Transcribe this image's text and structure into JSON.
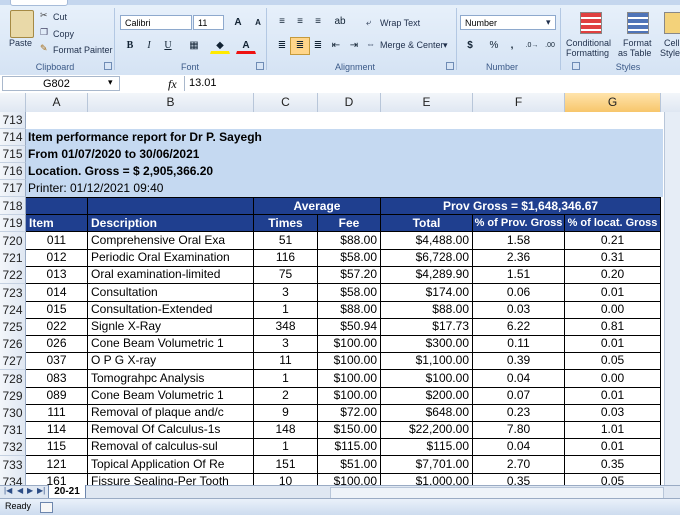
{
  "ribbon": {
    "clipboard": {
      "paste": "Paste",
      "cut": "Cut",
      "copy": "Copy",
      "format_painter": "Format Painter",
      "label": "Clipboard"
    },
    "font": {
      "name": "Calibri",
      "size": "11",
      "bold": "B",
      "italic": "I",
      "underline": "U",
      "label": "Font"
    },
    "alignment": {
      "wrap_text": "Wrap Text",
      "merge_center": "Merge & Center",
      "label": "Alignment"
    },
    "number": {
      "format": "Number",
      "currency": "$",
      "percent": "%",
      "comma": ",",
      "label": "Number"
    },
    "styles": {
      "conditional": "Conditional",
      "formatting": "Formatting",
      "format": "Format",
      "as_table": "as Table",
      "cell": "Cell",
      "styles_btn": "Styles",
      "label": "Styles"
    }
  },
  "formula_bar": {
    "name_box": "G802",
    "fx": "fx",
    "value": "13.01"
  },
  "columns": [
    "A",
    "B",
    "C",
    "D",
    "E",
    "F",
    "G"
  ],
  "info_rows": [
    {
      "row": "713",
      "text": ""
    },
    {
      "row": "714",
      "text": "Item performance report for Dr P. Sayegh"
    },
    {
      "row": "715",
      "text": "From 01/07/2020 to 30/06/2021"
    },
    {
      "row": "716",
      "text": "Location. Gross = $ 2,905,366.20"
    },
    {
      "row": "717",
      "text": "Printer: 01/12/2021 09:40"
    }
  ],
  "header1": {
    "row": "718",
    "average": "Average",
    "prov_gross": "Prov Gross = $1,648,346.67"
  },
  "header2": {
    "row": "719",
    "item": "Item",
    "description": "Description",
    "times": "Times",
    "fee": "Fee",
    "total": "Total",
    "pct_prov": "% of Prov. Gross",
    "pct_locat": "% of locat. Gross"
  },
  "rows": [
    {
      "row": "720",
      "item": "011",
      "desc": "Comprehensive Oral Exa",
      "times": "51",
      "fee": "$88.00",
      "total": "$4,488.00",
      "prov": "1.58",
      "locat": "0.21"
    },
    {
      "row": "721",
      "item": "012",
      "desc": "Periodic Oral Examination",
      "times": "116",
      "fee": "$58.00",
      "total": "$6,728.00",
      "prov": "2.36",
      "locat": "0.31"
    },
    {
      "row": "722",
      "item": "013",
      "desc": "Oral examination-limited",
      "times": "75",
      "fee": "$57.20",
      "total": "$4,289.90",
      "prov": "1.51",
      "locat": "0.20"
    },
    {
      "row": "723",
      "item": "014",
      "desc": "Consultation",
      "times": "3",
      "fee": "$58.00",
      "total": "$174.00",
      "prov": "0.06",
      "locat": "0.01"
    },
    {
      "row": "724",
      "item": "015",
      "desc": "Consultation-Extended",
      "times": "1",
      "fee": "$88.00",
      "total": "$88.00",
      "prov": "0.03",
      "locat": "0.00"
    },
    {
      "row": "725",
      "item": "022",
      "desc": "Signle X-Ray",
      "times": "348",
      "fee": "$50.94",
      "total": "$17.73",
      "prov": "6.22",
      "locat": "0.81"
    },
    {
      "row": "726",
      "item": "026",
      "desc": "Cone Beam Volumetric 1",
      "times": "3",
      "fee": "$100.00",
      "total": "$300.00",
      "prov": "0.11",
      "locat": "0.01"
    },
    {
      "row": "727",
      "item": "037",
      "desc": "O P G X-ray",
      "times": "11",
      "fee": "$100.00",
      "total": "$1,100.00",
      "prov": "0.39",
      "locat": "0.05"
    },
    {
      "row": "728",
      "item": "083",
      "desc": "Tomograhpc Analysis",
      "times": "1",
      "fee": "$100.00",
      "total": "$100.00",
      "prov": "0.04",
      "locat": "0.00"
    },
    {
      "row": "729",
      "item": "089",
      "desc": "Cone Beam Volumetric 1",
      "times": "2",
      "fee": "$100.00",
      "total": "$200.00",
      "prov": "0.07",
      "locat": "0.01"
    },
    {
      "row": "730",
      "item": "111",
      "desc": "Removal of plaque and/c",
      "times": "9",
      "fee": "$72.00",
      "total": "$648.00",
      "prov": "0.23",
      "locat": "0.03"
    },
    {
      "row": "731",
      "item": "114",
      "desc": "Removal Of Calculus-1s",
      "times": "148",
      "fee": "$150.00",
      "total": "$22,200.00",
      "prov": "7.80",
      "locat": "1.01"
    },
    {
      "row": "732",
      "item": "115",
      "desc": "Removal of calculus-sul",
      "times": "1",
      "fee": "$115.00",
      "total": "$115.00",
      "prov": "0.04",
      "locat": "0.01"
    },
    {
      "row": "733",
      "item": "121",
      "desc": "Topical Application Of Re",
      "times": "151",
      "fee": "$51.00",
      "total": "$7,701.00",
      "prov": "2.70",
      "locat": "0.35"
    },
    {
      "row": "734",
      "item": "161",
      "desc": "Fissure Sealing-Per Tooth",
      "times": "10",
      "fee": "$100.00",
      "total": "$1,000.00",
      "prov": "0.35",
      "locat": "0.05"
    }
  ],
  "sheet_tab": "20-21",
  "status": "Ready",
  "colors": {
    "header_blue": "#1f3f8f",
    "info_blue": "#c5d9f1",
    "selected_col": "#ffd58a"
  }
}
